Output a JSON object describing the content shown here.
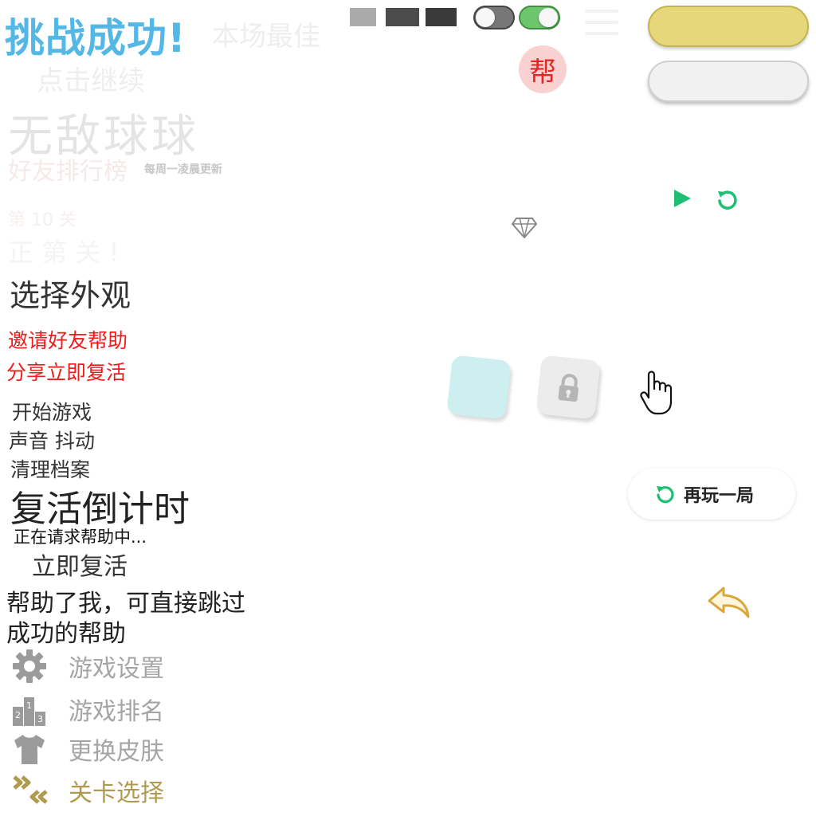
{
  "header": {
    "success_title": "挑战成功!",
    "best_title": "本场最佳",
    "tap_continue": "点击继续",
    "game_title": "无敌球球",
    "friends_rank": "好友排行榜",
    "weekly_update": "每周一凌晨更新",
    "level_label": "第 10 关",
    "faded_text": "正 第 关 !"
  },
  "help_badge": "帮",
  "colors": {
    "swatch_1": "#aaaaaa",
    "swatch_2": "#4b4b4b",
    "swatch_3": "#3a3a3a",
    "accent_green": "#1dbf73",
    "accent_red": "#ee1c1c",
    "title_blue": "#55b7e6",
    "pill_yellow": "#e6d77a",
    "gold": "#b09a4f"
  },
  "toggles": {
    "sound_on": false,
    "vibrate_on": true
  },
  "menu_texts": {
    "choose_skin": "选择外观",
    "invite_help": "邀请好友帮助",
    "share_revive": "分享立即复活",
    "start_game": "开始游戏",
    "sound_vibrate": "声音 抖动",
    "clear_data": "清理档案",
    "countdown_title": "复活倒计时",
    "requesting": "正在请求帮助中...",
    "revive_now": "立即复活",
    "helped_skip": "帮助了我，可直接跳过",
    "success_help": "成功的帮助"
  },
  "skins": [
    {
      "name": "cyan",
      "color": "#cdeff0",
      "locked": false
    },
    {
      "name": "locked",
      "color": "#ececec",
      "locked": true
    }
  ],
  "replay_button": {
    "label": "再玩一局",
    "icon": "replay-icon"
  },
  "bottom_menu": [
    {
      "icon": "gear-icon",
      "label": "游戏设置"
    },
    {
      "icon": "podium-icon",
      "label": "游戏排名"
    },
    {
      "icon": "shirt-icon",
      "label": "更换皮肤"
    },
    {
      "icon": "chevrons-icon",
      "label": "关卡选择"
    }
  ],
  "podium_digits": [
    "1",
    "2",
    "3"
  ]
}
